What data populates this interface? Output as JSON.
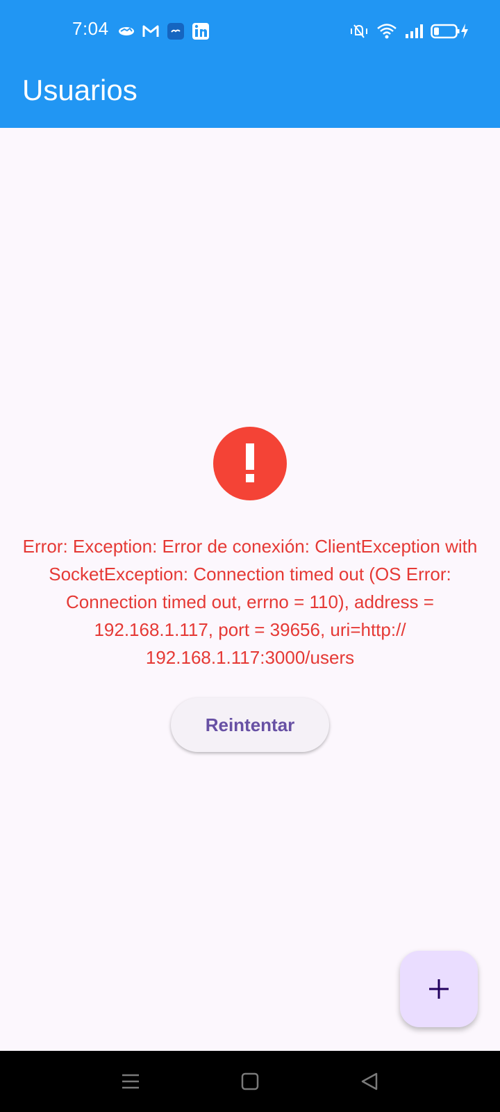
{
  "status_bar": {
    "time": "7:04",
    "left_icons": [
      "handshake-icon",
      "gmail-icon",
      "chat-app-icon",
      "linkedin-icon"
    ],
    "right_icons": [
      "vibrate-icon",
      "wifi-icon",
      "signal-icon",
      "battery-charging-icon"
    ]
  },
  "app_bar": {
    "title": "Usuarios",
    "color": "#2196f3"
  },
  "error": {
    "icon": "error-icon",
    "message": "Error: Exception: Error de conexión: ClientException with SocketException: Connection timed out (OS Error: Connection timed out, errno = 110), address = 192.168.1.117, port = 39656, uri=http:// 192.168.1.117:3000/users",
    "color": "#e53935"
  },
  "retry_button": {
    "label": "Reintentar"
  },
  "fab": {
    "icon": "add-icon",
    "color": "#eaddff"
  },
  "nav_bar": {
    "buttons": [
      "menu-icon",
      "home-icon",
      "back-icon"
    ]
  }
}
